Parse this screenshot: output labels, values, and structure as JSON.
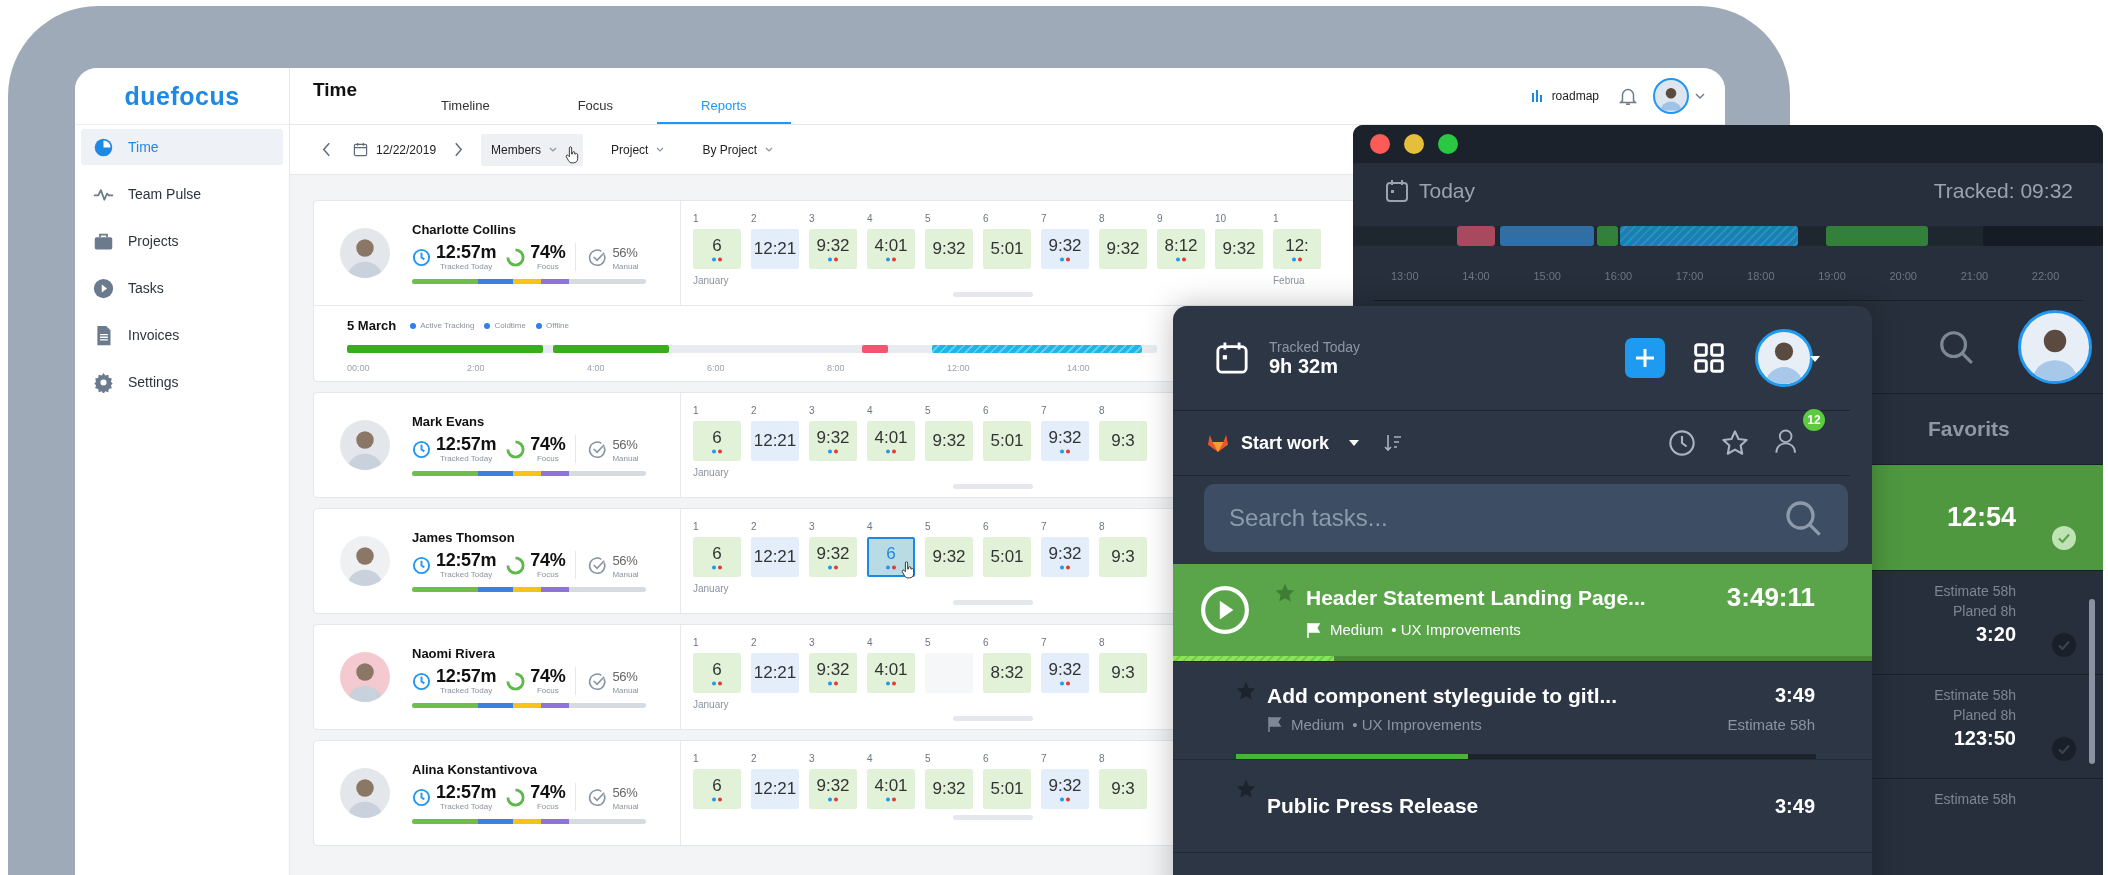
{
  "app": {
    "logo": "duefocus",
    "title": "Time",
    "tabs": [
      {
        "label": "Timeline",
        "selected": false
      },
      {
        "label": "Focus",
        "selected": false
      },
      {
        "label": "Reports",
        "selected": true
      }
    ],
    "roadmap": "roadmap",
    "sidebar": [
      {
        "label": "Time",
        "selected": true
      },
      {
        "label": "Team Pulse",
        "selected": false
      },
      {
        "label": "Projects",
        "selected": false
      },
      {
        "label": "Tasks",
        "selected": false
      },
      {
        "label": "Invoices",
        "selected": false
      },
      {
        "label": "Settings",
        "selected": false
      }
    ],
    "toolbar": {
      "date": "12/22/2019",
      "filters": [
        {
          "label": "Members",
          "selected": true
        },
        {
          "label": "Project",
          "selected": false
        },
        {
          "label": "By Project",
          "selected": false
        }
      ]
    },
    "members": [
      {
        "name": "Charlotte Collins",
        "tracked": {
          "value": "12:57m",
          "label": "Tracked Today"
        },
        "focus": {
          "value": "74%",
          "label": "Focus"
        },
        "manual": {
          "value": "56%",
          "label": "Manual"
        },
        "days": [
          {
            "day": "1",
            "value": "6",
            "kind": "green",
            "dots": true,
            "selected": false,
            "month": "January"
          },
          {
            "day": "2",
            "value": "12:21",
            "kind": "blue",
            "dots": false,
            "selected": false
          },
          {
            "day": "3",
            "value": "9:32",
            "kind": "green",
            "dots": true,
            "selected": false
          },
          {
            "day": "4",
            "value": "4:01",
            "kind": "green",
            "dots": true,
            "selected": false
          },
          {
            "day": "5",
            "value": "9:32",
            "kind": "green",
            "dots": false,
            "selected": false
          },
          {
            "day": "6",
            "value": "5:01",
            "kind": "green",
            "dots": false,
            "selected": false
          },
          {
            "day": "7",
            "value": "9:32",
            "kind": "blue",
            "dots": true,
            "selected": false
          },
          {
            "day": "8",
            "value": "9:32",
            "kind": "green",
            "dots": false,
            "selected": false
          },
          {
            "day": "9",
            "value": "8:12",
            "kind": "green",
            "dots": true,
            "selected": false
          },
          {
            "day": "10",
            "value": "9:32",
            "kind": "green",
            "dots": false,
            "selected": false
          },
          {
            "day": "1",
            "value": "12:",
            "kind": "green",
            "dots": true,
            "selected": false,
            "month": "Februa"
          }
        ],
        "detail": {
          "date": "5 March",
          "legend": [
            {
              "label": "Active Tracking",
              "color": "#2f80ed"
            },
            {
              "label": "Coldtime",
              "color": "#2f80ed"
            },
            {
              "label": "Offline",
              "color": "#2f80ed"
            }
          ],
          "hours": [
            "00:00",
            "2:00",
            "4:00",
            "6:00",
            "8:00",
            "12:00",
            "14:00"
          ]
        }
      },
      {
        "name": "Mark Evans",
        "tracked": {
          "value": "12:57m",
          "label": "Tracked Today"
        },
        "focus": {
          "value": "74%",
          "label": "Focus"
        },
        "manual": {
          "value": "56%",
          "label": "Manual"
        },
        "days": [
          {
            "day": "1",
            "value": "6",
            "kind": "green",
            "dots": true,
            "selected": false,
            "month": "January"
          },
          {
            "day": "2",
            "value": "12:21",
            "kind": "blue",
            "dots": false,
            "selected": false
          },
          {
            "day": "3",
            "value": "9:32",
            "kind": "green",
            "dots": true,
            "selected": false
          },
          {
            "day": "4",
            "value": "4:01",
            "kind": "green",
            "dots": true,
            "selected": false
          },
          {
            "day": "5",
            "value": "9:32",
            "kind": "green",
            "dots": false,
            "selected": false
          },
          {
            "day": "6",
            "value": "5:01",
            "kind": "green",
            "dots": false,
            "selected": false
          },
          {
            "day": "7",
            "value": "9:32",
            "kind": "blue",
            "dots": true,
            "selected": false
          },
          {
            "day": "8",
            "value": "9:3",
            "kind": "green",
            "dots": false,
            "selected": false
          }
        ]
      },
      {
        "name": "James Thomson",
        "tracked": {
          "value": "12:57m",
          "label": "Tracked Today"
        },
        "focus": {
          "value": "74%",
          "label": "Focus"
        },
        "manual": {
          "value": "56%",
          "label": "Manual"
        },
        "days": [
          {
            "day": "1",
            "value": "6",
            "kind": "green",
            "dots": true,
            "selected": false,
            "month": "January"
          },
          {
            "day": "2",
            "value": "12:21",
            "kind": "blue",
            "dots": false,
            "selected": false
          },
          {
            "day": "3",
            "value": "9:32",
            "kind": "green",
            "dots": true,
            "selected": false
          },
          {
            "day": "4",
            "value": "6",
            "kind": "blue",
            "dots": true,
            "selected": true
          },
          {
            "day": "5",
            "value": "9:32",
            "kind": "green",
            "dots": false,
            "selected": false
          },
          {
            "day": "6",
            "value": "5:01",
            "kind": "green",
            "dots": false,
            "selected": false
          },
          {
            "day": "7",
            "value": "9:32",
            "kind": "blue",
            "dots": true,
            "selected": false
          },
          {
            "day": "8",
            "value": "9:3",
            "kind": "green",
            "dots": false,
            "selected": false
          }
        ]
      },
      {
        "name": "Naomi Rivera",
        "tracked": {
          "value": "12:57m",
          "label": "Tracked Today"
        },
        "focus": {
          "value": "74%",
          "label": "Focus"
        },
        "manual": {
          "value": "56%",
          "label": "Manual"
        },
        "days": [
          {
            "day": "1",
            "value": "6",
            "kind": "green",
            "dots": true,
            "selected": false,
            "month": "January"
          },
          {
            "day": "2",
            "value": "12:21",
            "kind": "blue",
            "dots": false,
            "selected": false
          },
          {
            "day": "3",
            "value": "9:32",
            "kind": "green",
            "dots": true,
            "selected": false
          },
          {
            "day": "4",
            "value": "4:01",
            "kind": "green",
            "dots": true,
            "selected": false
          },
          {
            "day": "5",
            "kind": "empty",
            "dots": false,
            "selected": false
          },
          {
            "day": "6",
            "value": "8:32",
            "kind": "green",
            "dots": false,
            "selected": false
          },
          {
            "day": "7",
            "value": "9:32",
            "kind": "blue",
            "dots": true,
            "selected": false
          },
          {
            "day": "8",
            "value": "9:3",
            "kind": "green",
            "dots": false,
            "selected": false
          }
        ]
      },
      {
        "name": "Alina Konstantivova",
        "tracked": {
          "value": "12:57m",
          "label": "Tracked Today"
        },
        "focus": {
          "value": "74%",
          "label": "Focus"
        },
        "manual": {
          "value": "56%",
          "label": "Manual"
        },
        "days": [
          {
            "day": "1",
            "value": "6",
            "kind": "green",
            "dots": true,
            "selected": false
          },
          {
            "day": "2",
            "value": "12:21",
            "kind": "blue",
            "dots": false,
            "selected": false
          },
          {
            "day": "3",
            "value": "9:32",
            "kind": "green",
            "dots": true,
            "selected": false
          },
          {
            "day": "4",
            "value": "4:01",
            "kind": "green",
            "dots": true,
            "selected": false
          },
          {
            "day": "5",
            "value": "9:32",
            "kind": "green",
            "dots": false,
            "selected": false
          },
          {
            "day": "6",
            "value": "5:01",
            "kind": "green",
            "dots": false,
            "selected": false
          },
          {
            "day": "7",
            "value": "9:32",
            "kind": "blue",
            "dots": true,
            "selected": false
          },
          {
            "day": "8",
            "value": "9:3",
            "kind": "green",
            "dots": false,
            "selected": false
          }
        ]
      }
    ]
  },
  "tracker_back": {
    "today": "Today",
    "tracked": "Tracked: 09:32",
    "hours": [
      "13:00",
      "14:00",
      "15:00",
      "16:00",
      "17:00",
      "18:00",
      "19:00",
      "20:00",
      "21:00",
      "22:00"
    ],
    "tab": "Favorits",
    "favorites": [
      {
        "active": true,
        "time": "12:54"
      },
      {
        "active": false,
        "estimate": "Estimate 58h",
        "planned": "Planed 8h",
        "time": "3:20"
      },
      {
        "active": false,
        "estimate": "Estimate 58h",
        "planned": "Planed 8h",
        "time": "123:50"
      },
      {
        "active": false,
        "estimate": "Estimate 58h"
      }
    ]
  },
  "tracker_front": {
    "label": "Tracked Today",
    "total": "9h 32m",
    "project": "Start work",
    "badge": "12",
    "search": {
      "placeholder": "Search tasks..."
    },
    "tasks": [
      {
        "active": true,
        "title": "Header Statement Landing Page...",
        "time": "3:49:11",
        "priority": "Medium",
        "tag": "• UX Improvements",
        "level": 0.23
      },
      {
        "active": false,
        "title": "Add component styleguide to gitl...",
        "time": "3:49",
        "priority": "Medium",
        "tag": "• UX Improvements",
        "estimate": "Estimate 58h",
        "level": 0.4
      },
      {
        "active": false,
        "title": "Public Press Release",
        "time": "3:49"
      }
    ]
  }
}
